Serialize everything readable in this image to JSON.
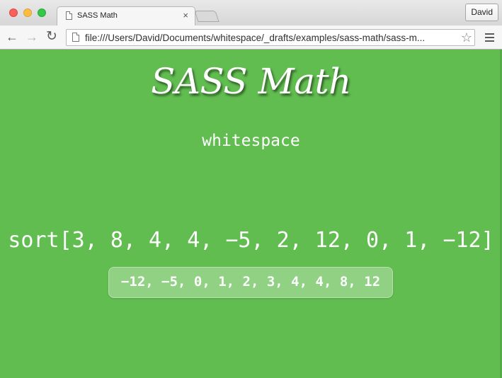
{
  "browser": {
    "tab": {
      "title": "SASS Math",
      "close_glyph": "×"
    },
    "profile_label": "David",
    "nav": {
      "back_glyph": "←",
      "forward_glyph": "→",
      "reload_glyph": "↻"
    },
    "address_bar": {
      "value": "file:///Users/David/Documents/whitespace/_drafts/examples/sass-math/sass-m..."
    },
    "star_glyph": "☆"
  },
  "page": {
    "title": "SASS Math",
    "subtitle": "whitespace",
    "expression": "sort[3, 8, 4, 4, −5, 2, 12, 0, 1, −12]",
    "result": "−12, −5, 0, 1, 2, 3, 4, 4, 8, 12",
    "background_color": "#61bd50"
  }
}
